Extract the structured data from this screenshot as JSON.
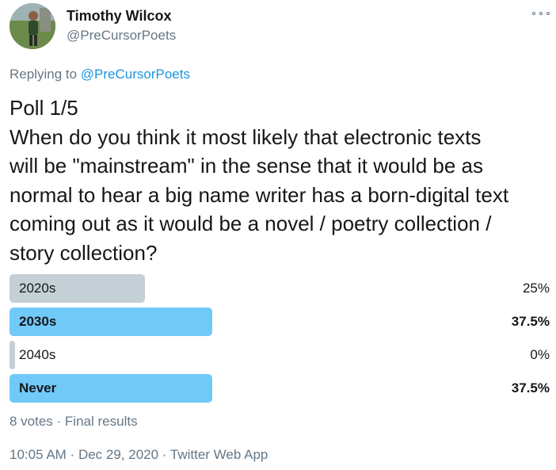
{
  "author": {
    "name": "Timothy Wilcox",
    "handle": "@PreCursorPoets",
    "avatar_icon": "profile-photo"
  },
  "reply": {
    "prefix": "Replying to ",
    "mention": "@PreCursorPoets"
  },
  "tweet": {
    "text_lines": [
      "Poll 1/5",
      "When do you think it most likely that electronic texts",
      "will be \"mainstream\" in the sense that it would be as",
      "normal to hear a big name writer has a born-digital text",
      "coming out as it would be a novel / poetry collection /",
      "story collection?"
    ]
  },
  "poll": {
    "options": [
      {
        "label": "2020s",
        "percent": "25%",
        "fraction": 0.25,
        "winner": false,
        "color": "#c4cfd6"
      },
      {
        "label": "2030s",
        "percent": "37.5%",
        "fraction": 0.375,
        "winner": true,
        "color": "#71c9f8"
      },
      {
        "label": "2040s",
        "percent": "0%",
        "fraction": 0,
        "winner": false,
        "color": "#c4cfd6"
      },
      {
        "label": "Never",
        "percent": "37.5%",
        "fraction": 0.375,
        "winner": true,
        "color": "#71c9f8"
      }
    ],
    "votes": "8 votes",
    "separator": " · ",
    "status": "Final results"
  },
  "timestamp": {
    "time": "10:05 AM",
    "date": "Dec 29, 2020",
    "client": "Twitter Web App",
    "separator": " · "
  },
  "colors": {
    "text": "#14171a",
    "secondary": "#657786",
    "link": "#1b95e0",
    "bar_neutral": "#c4cfd6",
    "bar_winner": "#71c9f8"
  }
}
